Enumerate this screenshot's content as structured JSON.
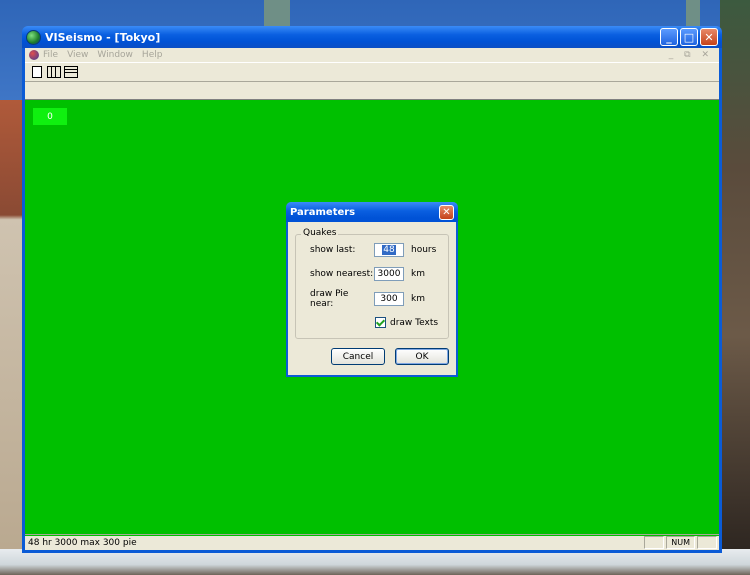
{
  "window": {
    "title": "VISeismo - [Tokyo]",
    "minimize_symbol": "_",
    "maximize_symbol": "□",
    "close_symbol": "✕"
  },
  "menu": {
    "items": [
      "File",
      "View",
      "Window",
      "Help"
    ],
    "mdi_controls": "_ ⧉ ✕"
  },
  "canvas": {
    "background_color": "#00c000",
    "counter": "0"
  },
  "dialog": {
    "title": "Parameters",
    "close_symbol": "✕",
    "group_label": "Quakes",
    "fields": [
      {
        "label": "show last:",
        "value": "48",
        "unit": "hours"
      },
      {
        "label": "show nearest:",
        "value": "3000",
        "unit": "km"
      },
      {
        "label": "draw Pie near:",
        "value": "300",
        "unit": "km"
      }
    ],
    "checkbox_label": "draw Texts",
    "checkbox_checked": true,
    "cancel_label": "Cancel",
    "ok_label": "OK"
  },
  "statusbar": {
    "text": "48 hr   3000 max   300 pie",
    "num_indicator": "NUM"
  }
}
